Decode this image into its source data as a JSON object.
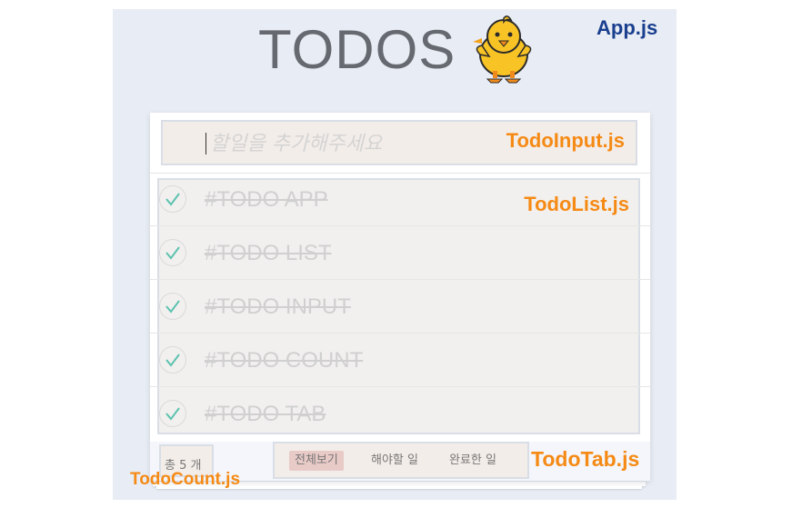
{
  "app": {
    "title": "TODOS",
    "file_label": "App.js",
    "mascot_icon": "baby-chick-icon"
  },
  "todo_input": {
    "placeholder": "할일을 추가해주세요",
    "value": "",
    "file_label": "TodoInput.js"
  },
  "todo_list": {
    "file_label": "TodoList.js",
    "items": [
      {
        "label": "#TODO APP",
        "completed": true
      },
      {
        "label": "#TODO LIST",
        "completed": true
      },
      {
        "label": "#TODO INPUT",
        "completed": true
      },
      {
        "label": "#TODO COUNT",
        "completed": true
      },
      {
        "label": "#TODO TAB",
        "completed": true
      }
    ]
  },
  "todo_count": {
    "text": "총 5 개",
    "file_label": "TodoCount.js"
  },
  "todo_tab": {
    "file_label": "TodoTab.js",
    "tabs": [
      {
        "label": "전체보기",
        "selected": true
      },
      {
        "label": "해야할 일",
        "selected": false
      },
      {
        "label": "완료한 일",
        "selected": false
      }
    ]
  },
  "colors": {
    "annotation_orange": "#f58a15",
    "annotation_blue": "#1a3f8f",
    "check_green": "#5dc2af",
    "app_background": "#e8ecf4",
    "selected_tab": "#e8cac7"
  }
}
